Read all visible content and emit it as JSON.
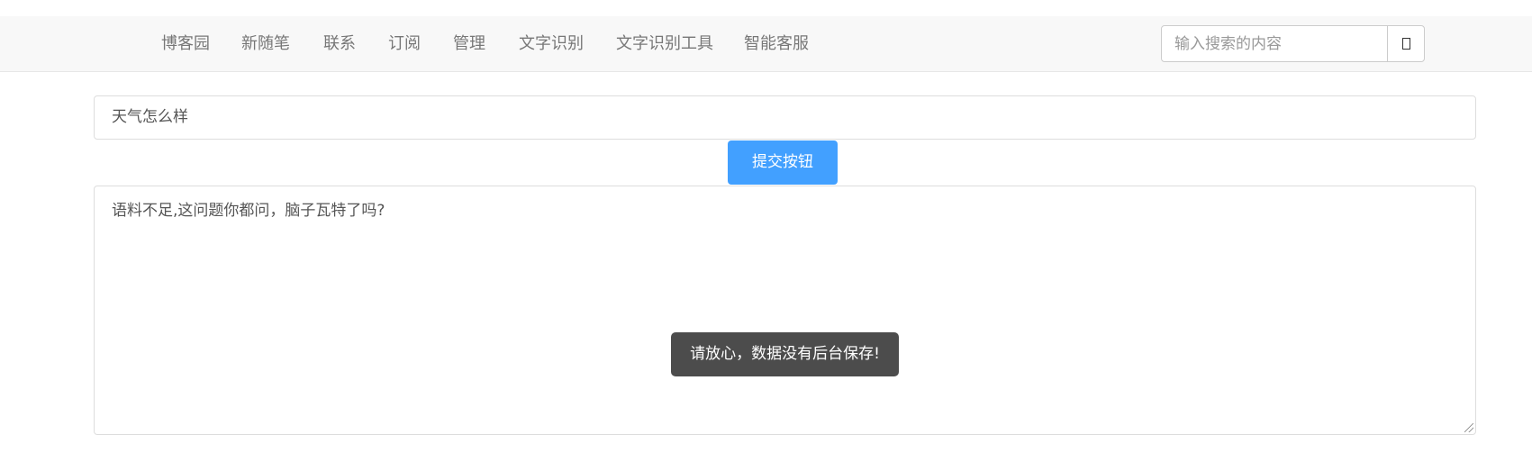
{
  "navbar": {
    "items": [
      "博客园",
      "新随笔",
      "联系",
      "订阅",
      "管理",
      "文字识别",
      "文字识别工具",
      "智能客服"
    ],
    "search_placeholder": "输入搜索的内容",
    "search_icon": "search-icon"
  },
  "form": {
    "question_value": "天气怎么样",
    "submit_label": "提交按钮",
    "answer_value": "语料不足,这问题你都问，脑子瓦特了吗?"
  },
  "toast": {
    "message": "请放心，数据没有后台保存!"
  },
  "colors": {
    "accent": "#42a0ff",
    "toast_bg": "#4c4c4c",
    "navbar_bg": "#f8f8f8"
  }
}
